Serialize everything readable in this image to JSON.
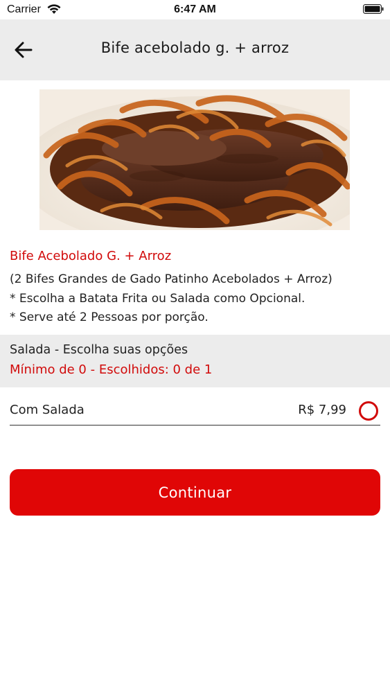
{
  "status_bar": {
    "carrier": "Carrier",
    "time": "6:47 AM"
  },
  "header": {
    "title": "Bife acebolado g. + arroz"
  },
  "product": {
    "name": "Bife Acebolado G. + Arroz",
    "description_lines": [
      "(2 Bifes Grandes de Gado Patinho Acebolados + Arroz)",
      "* Escolha a Batata Frita ou Salada como Opcional.",
      "* Serve até 2 Pessoas por porção."
    ]
  },
  "options_group": {
    "title": "Salada - Escolha suas opções",
    "subtitle": "Mínimo de 0 - Escolhidos: 0 de 1",
    "items": [
      {
        "label": "Com Salada",
        "price": "R$ 7,99",
        "selected": false
      }
    ]
  },
  "actions": {
    "continue_label": "Continuar"
  },
  "colors": {
    "accent": "#d10a0a",
    "button": "#e00606",
    "header_bg": "#ececec"
  }
}
